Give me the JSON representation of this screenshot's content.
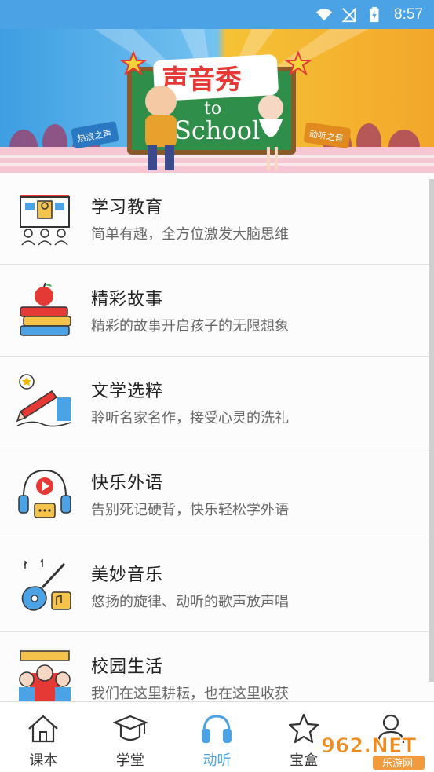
{
  "status_bar": {
    "time": "8:57"
  },
  "banner": {
    "title": "声音秀",
    "left_tag": "热浪之声",
    "right_tag": "动听之音",
    "board_line1": "to",
    "board_line2": "School"
  },
  "list": {
    "items": [
      {
        "title": "学习教育",
        "subtitle": "简单有趣，全方位激发大脑思维",
        "icon": "classroom-icon"
      },
      {
        "title": "精彩故事",
        "subtitle": "精彩的故事开启孩子的无限想象",
        "icon": "books-apple-icon"
      },
      {
        "title": "文学选粹",
        "subtitle": "聆听名家名作，接受心灵的洗礼",
        "icon": "pen-writing-icon"
      },
      {
        "title": "快乐外语",
        "subtitle": "告别死记硬背，快乐轻松学外语",
        "icon": "headphones-play-icon"
      },
      {
        "title": "美妙音乐",
        "subtitle": "悠扬的旋律、动听的歌声放声唱",
        "icon": "guitar-icon"
      },
      {
        "title": "校园生活",
        "subtitle": "我们在这里耕耘，也在这里收获",
        "icon": "students-icon"
      }
    ]
  },
  "tabbar": {
    "tabs": [
      {
        "label": "课本",
        "icon": "house-icon",
        "active": false
      },
      {
        "label": "学堂",
        "icon": "graduation-cap-icon",
        "active": false
      },
      {
        "label": "动听",
        "icon": "headphones-icon",
        "active": true
      },
      {
        "label": "宝盒",
        "icon": "star-icon",
        "active": false
      },
      {
        "label": "",
        "icon": "person-icon",
        "active": false
      }
    ]
  },
  "watermark": {
    "text": "962.NET",
    "sub": "乐游网"
  },
  "colors": {
    "accent": "#4ba3e6",
    "red": "#e53935",
    "yellow": "#f5b700"
  }
}
